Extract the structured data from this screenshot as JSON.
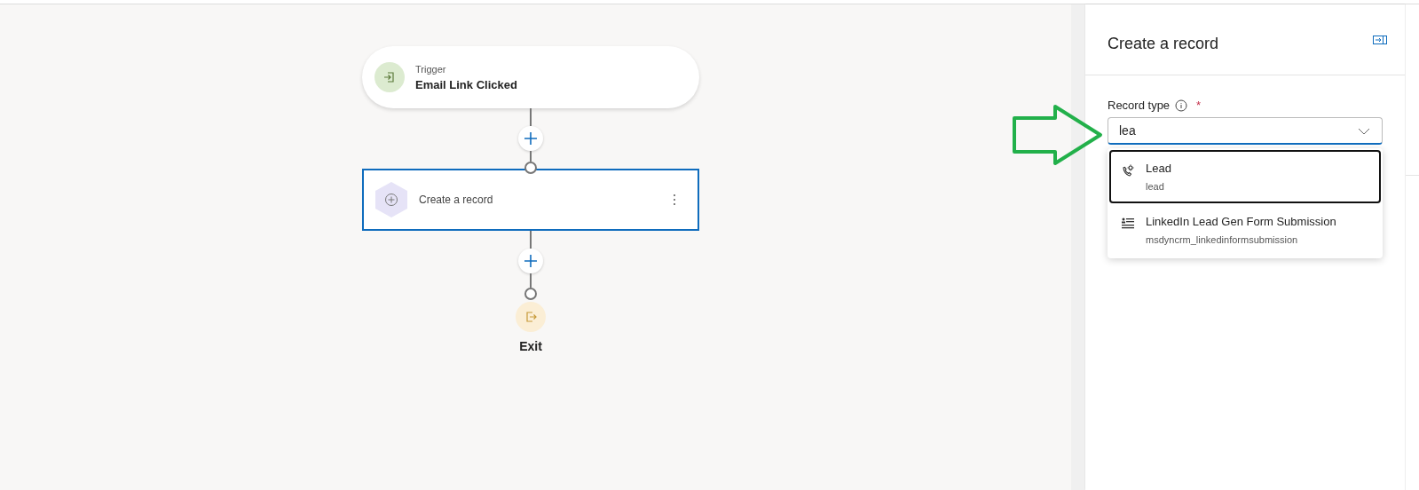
{
  "flow": {
    "trigger": {
      "label": "Trigger",
      "title": "Email Link Clicked"
    },
    "action": {
      "title": "Create a record",
      "selected": true
    },
    "exit": {
      "label": "Exit"
    }
  },
  "panel": {
    "title": "Create a record",
    "field": {
      "label": "Record type",
      "required": true,
      "required_mark": "*",
      "value": "lea"
    },
    "options": [
      {
        "kind": "lead",
        "title": "Lead",
        "subtitle": "lead",
        "selected": true
      },
      {
        "kind": "form",
        "title": "LinkedIn Lead Gen Form Submission",
        "subtitle": "msdyncrm_linkedinformsubmission",
        "selected": false
      }
    ]
  }
}
